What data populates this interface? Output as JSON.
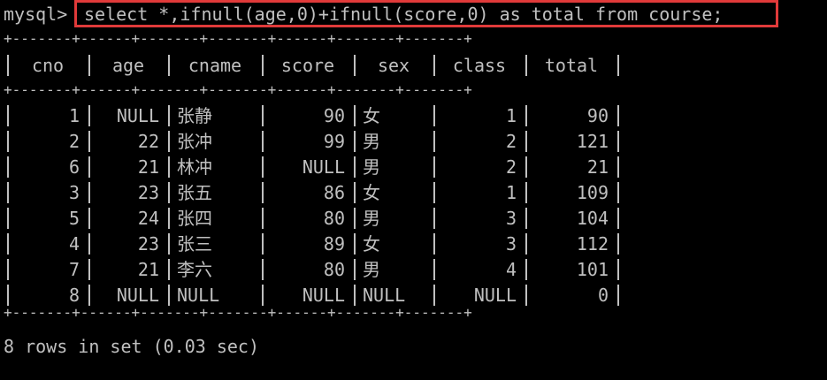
{
  "terminal": {
    "prompt": "mysql>",
    "command": "select *,ifnull(age,0)+ifnull(score,0) as total from course;",
    "border_line": "+-------+------+-------+-------+------+-------+-------+",
    "footer": "8 rows in set (0.03 sec)"
  },
  "table": {
    "headers": [
      "cno",
      "age",
      "cname",
      "score",
      "sex",
      "class",
      "total"
    ],
    "rows": [
      [
        "1",
        "NULL",
        "张静",
        "90",
        "女",
        "1",
        "90"
      ],
      [
        "2",
        "22",
        "张冲",
        "99",
        "男",
        "2",
        "121"
      ],
      [
        "6",
        "21",
        "林冲",
        "NULL",
        "男",
        "2",
        "21"
      ],
      [
        "3",
        "23",
        "张五",
        "86",
        "女",
        "1",
        "109"
      ],
      [
        "5",
        "24",
        "张四",
        "80",
        "男",
        "3",
        "104"
      ],
      [
        "4",
        "23",
        "张三",
        "89",
        "女",
        "3",
        "112"
      ],
      [
        "7",
        "21",
        "李六",
        "80",
        "男",
        "4",
        "101"
      ],
      [
        "8",
        "NULL",
        "NULL",
        "NULL",
        "NULL",
        "NULL",
        "0"
      ]
    ]
  }
}
